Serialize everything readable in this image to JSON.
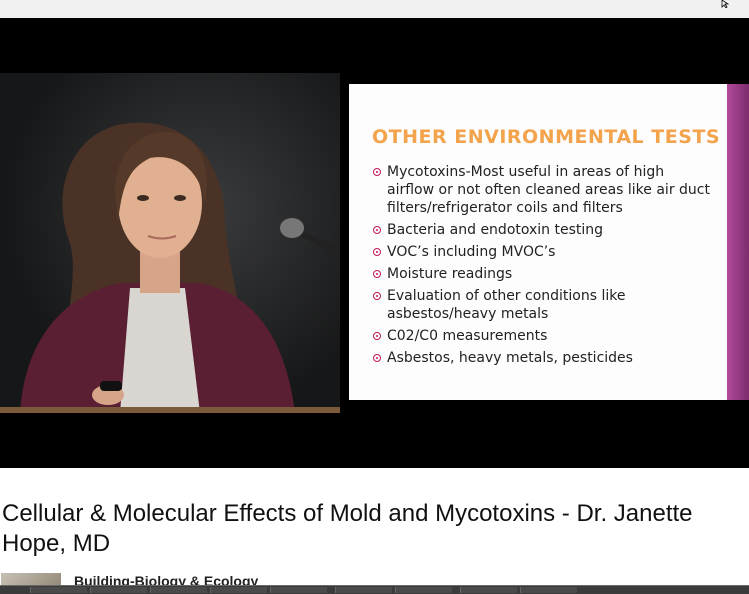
{
  "video": {
    "title": "Cellular & Molecular Effects of Mold and Mycotoxins - Dr. Janette Hope, MD",
    "channel": "Building-Biology & Ecology"
  },
  "slide": {
    "title": "OTHER ENVIRONMENTAL TESTS",
    "bullets": [
      "Mycotoxins-Most useful in areas of high airflow or not often cleaned areas like air duct filters/refrigerator coils and filters",
      "Bacteria and endotoxin testing",
      "VOC’s including MVOC’s",
      "Moisture readings",
      "Evaluation of other conditions like asbestos/heavy metals",
      "C02/C0 measurements",
      "Asbestos, heavy metals, pesticides"
    ]
  },
  "colors": {
    "slide_title": "#f2a34b",
    "bullet": "#c2185b",
    "slide_edge": "#b24a9a"
  }
}
